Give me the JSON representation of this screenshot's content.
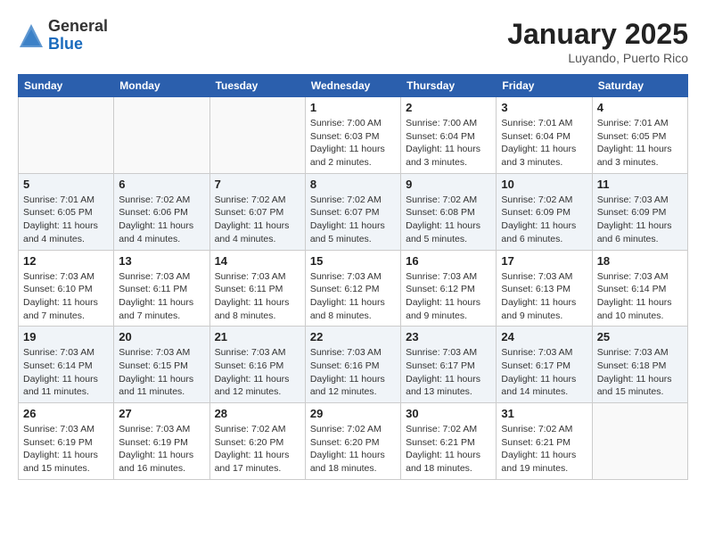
{
  "header": {
    "logo_general": "General",
    "logo_blue": "Blue",
    "month_title": "January 2025",
    "location": "Luyando, Puerto Rico"
  },
  "calendar": {
    "days_of_week": [
      "Sunday",
      "Monday",
      "Tuesday",
      "Wednesday",
      "Thursday",
      "Friday",
      "Saturday"
    ],
    "weeks": [
      [
        {
          "day": "",
          "info": ""
        },
        {
          "day": "",
          "info": ""
        },
        {
          "day": "",
          "info": ""
        },
        {
          "day": "1",
          "info": "Sunrise: 7:00 AM\nSunset: 6:03 PM\nDaylight: 11 hours\nand 2 minutes."
        },
        {
          "day": "2",
          "info": "Sunrise: 7:00 AM\nSunset: 6:04 PM\nDaylight: 11 hours\nand 3 minutes."
        },
        {
          "day": "3",
          "info": "Sunrise: 7:01 AM\nSunset: 6:04 PM\nDaylight: 11 hours\nand 3 minutes."
        },
        {
          "day": "4",
          "info": "Sunrise: 7:01 AM\nSunset: 6:05 PM\nDaylight: 11 hours\nand 3 minutes."
        }
      ],
      [
        {
          "day": "5",
          "info": "Sunrise: 7:01 AM\nSunset: 6:05 PM\nDaylight: 11 hours\nand 4 minutes."
        },
        {
          "day": "6",
          "info": "Sunrise: 7:02 AM\nSunset: 6:06 PM\nDaylight: 11 hours\nand 4 minutes."
        },
        {
          "day": "7",
          "info": "Sunrise: 7:02 AM\nSunset: 6:07 PM\nDaylight: 11 hours\nand 4 minutes."
        },
        {
          "day": "8",
          "info": "Sunrise: 7:02 AM\nSunset: 6:07 PM\nDaylight: 11 hours\nand 5 minutes."
        },
        {
          "day": "9",
          "info": "Sunrise: 7:02 AM\nSunset: 6:08 PM\nDaylight: 11 hours\nand 5 minutes."
        },
        {
          "day": "10",
          "info": "Sunrise: 7:02 AM\nSunset: 6:09 PM\nDaylight: 11 hours\nand 6 minutes."
        },
        {
          "day": "11",
          "info": "Sunrise: 7:03 AM\nSunset: 6:09 PM\nDaylight: 11 hours\nand 6 minutes."
        }
      ],
      [
        {
          "day": "12",
          "info": "Sunrise: 7:03 AM\nSunset: 6:10 PM\nDaylight: 11 hours\nand 7 minutes."
        },
        {
          "day": "13",
          "info": "Sunrise: 7:03 AM\nSunset: 6:11 PM\nDaylight: 11 hours\nand 7 minutes."
        },
        {
          "day": "14",
          "info": "Sunrise: 7:03 AM\nSunset: 6:11 PM\nDaylight: 11 hours\nand 8 minutes."
        },
        {
          "day": "15",
          "info": "Sunrise: 7:03 AM\nSunset: 6:12 PM\nDaylight: 11 hours\nand 8 minutes."
        },
        {
          "day": "16",
          "info": "Sunrise: 7:03 AM\nSunset: 6:12 PM\nDaylight: 11 hours\nand 9 minutes."
        },
        {
          "day": "17",
          "info": "Sunrise: 7:03 AM\nSunset: 6:13 PM\nDaylight: 11 hours\nand 9 minutes."
        },
        {
          "day": "18",
          "info": "Sunrise: 7:03 AM\nSunset: 6:14 PM\nDaylight: 11 hours\nand 10 minutes."
        }
      ],
      [
        {
          "day": "19",
          "info": "Sunrise: 7:03 AM\nSunset: 6:14 PM\nDaylight: 11 hours\nand 11 minutes."
        },
        {
          "day": "20",
          "info": "Sunrise: 7:03 AM\nSunset: 6:15 PM\nDaylight: 11 hours\nand 11 minutes."
        },
        {
          "day": "21",
          "info": "Sunrise: 7:03 AM\nSunset: 6:16 PM\nDaylight: 11 hours\nand 12 minutes."
        },
        {
          "day": "22",
          "info": "Sunrise: 7:03 AM\nSunset: 6:16 PM\nDaylight: 11 hours\nand 12 minutes."
        },
        {
          "day": "23",
          "info": "Sunrise: 7:03 AM\nSunset: 6:17 PM\nDaylight: 11 hours\nand 13 minutes."
        },
        {
          "day": "24",
          "info": "Sunrise: 7:03 AM\nSunset: 6:17 PM\nDaylight: 11 hours\nand 14 minutes."
        },
        {
          "day": "25",
          "info": "Sunrise: 7:03 AM\nSunset: 6:18 PM\nDaylight: 11 hours\nand 15 minutes."
        }
      ],
      [
        {
          "day": "26",
          "info": "Sunrise: 7:03 AM\nSunset: 6:19 PM\nDaylight: 11 hours\nand 15 minutes."
        },
        {
          "day": "27",
          "info": "Sunrise: 7:03 AM\nSunset: 6:19 PM\nDaylight: 11 hours\nand 16 minutes."
        },
        {
          "day": "28",
          "info": "Sunrise: 7:02 AM\nSunset: 6:20 PM\nDaylight: 11 hours\nand 17 minutes."
        },
        {
          "day": "29",
          "info": "Sunrise: 7:02 AM\nSunset: 6:20 PM\nDaylight: 11 hours\nand 18 minutes."
        },
        {
          "day": "30",
          "info": "Sunrise: 7:02 AM\nSunset: 6:21 PM\nDaylight: 11 hours\nand 18 minutes."
        },
        {
          "day": "31",
          "info": "Sunrise: 7:02 AM\nSunset: 6:21 PM\nDaylight: 11 hours\nand 19 minutes."
        },
        {
          "day": "",
          "info": ""
        }
      ]
    ]
  }
}
